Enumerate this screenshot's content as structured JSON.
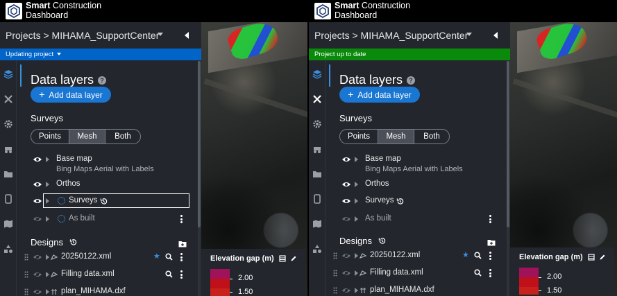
{
  "app": {
    "brand_bold": "Smart",
    "brand_rest": " Construction",
    "brand_line2": "Dashboard"
  },
  "left": {
    "breadcrumb": "Projects > MIHAMA_SupportCenter",
    "status": "Updating project",
    "status_color": "#0064c8"
  },
  "right": {
    "breadcrumb": "Projects > MIHAMA_SupportCenter",
    "status": "Project up to date",
    "status_color": "#0a8a0a"
  },
  "data_layers": {
    "title": "Data layers",
    "help": "?",
    "add_button": "Add data layer",
    "surveys_heading": "Surveys",
    "segments": [
      "Points",
      "Mesh",
      "Both"
    ],
    "active_segment": "Mesh",
    "layers": [
      {
        "label": "Base map",
        "sub": "Bing Maps Aerial with Labels"
      },
      {
        "label": "Orthos"
      },
      {
        "label": "Surveys"
      },
      {
        "label": "As built"
      }
    ],
    "designs_heading": "Designs",
    "designs": [
      {
        "label": "20250122.xml",
        "starred": true
      },
      {
        "label": "Filling data.xml"
      },
      {
        "label": "plan_MIHAMA.dxf"
      }
    ]
  },
  "elevation": {
    "title": "Elevation gap (m)",
    "labels": [
      "2.00",
      "1.50"
    ],
    "colors": [
      "#a0125a",
      "#c0101a",
      "#c8201a"
    ]
  },
  "icons": {
    "rail": [
      "layers-icon",
      "tools-icon",
      "gear-icon",
      "machine-icon",
      "folder-icon",
      "tablet-icon",
      "map-icon",
      "shapes-icon"
    ]
  }
}
